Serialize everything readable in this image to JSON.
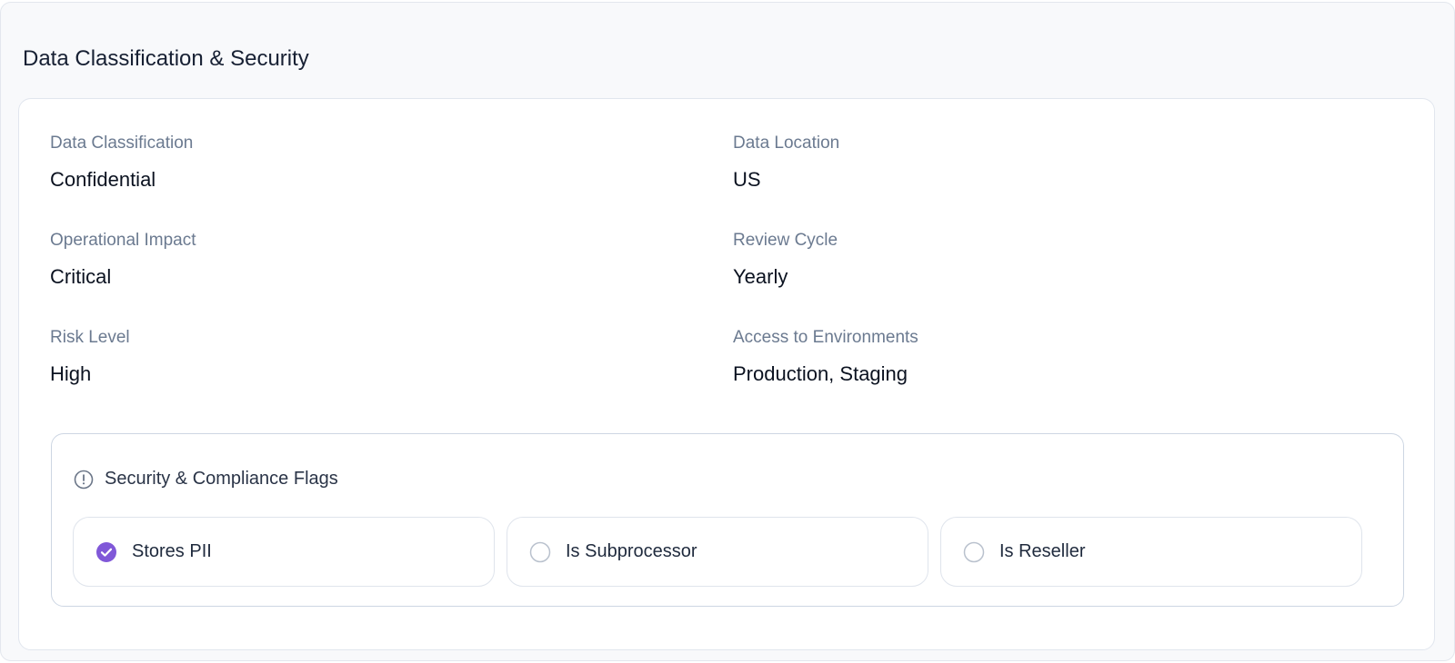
{
  "section": {
    "title": "Data Classification & Security"
  },
  "fields": {
    "data_classification": {
      "label": "Data Classification",
      "value": "Confidential"
    },
    "data_location": {
      "label": "Data Location",
      "value": "US"
    },
    "operational_impact": {
      "label": "Operational Impact",
      "value": "Critical"
    },
    "review_cycle": {
      "label": "Review Cycle",
      "value": "Yearly"
    },
    "risk_level": {
      "label": "Risk Level",
      "value": "High"
    },
    "access_environments": {
      "label": "Access to Environments",
      "value": "Production, Staging"
    }
  },
  "flags": {
    "title": "Security & Compliance Flags",
    "icon": "alert-circle-icon",
    "items": [
      {
        "label": "Stores PII",
        "checked": true
      },
      {
        "label": "Is Subprocessor",
        "checked": false
      },
      {
        "label": "Is Reseller",
        "checked": false
      }
    ]
  },
  "colors": {
    "accent": "#8058d8",
    "label": "#6b7a90",
    "value": "#0b1220",
    "border": "#dfe4ec"
  }
}
